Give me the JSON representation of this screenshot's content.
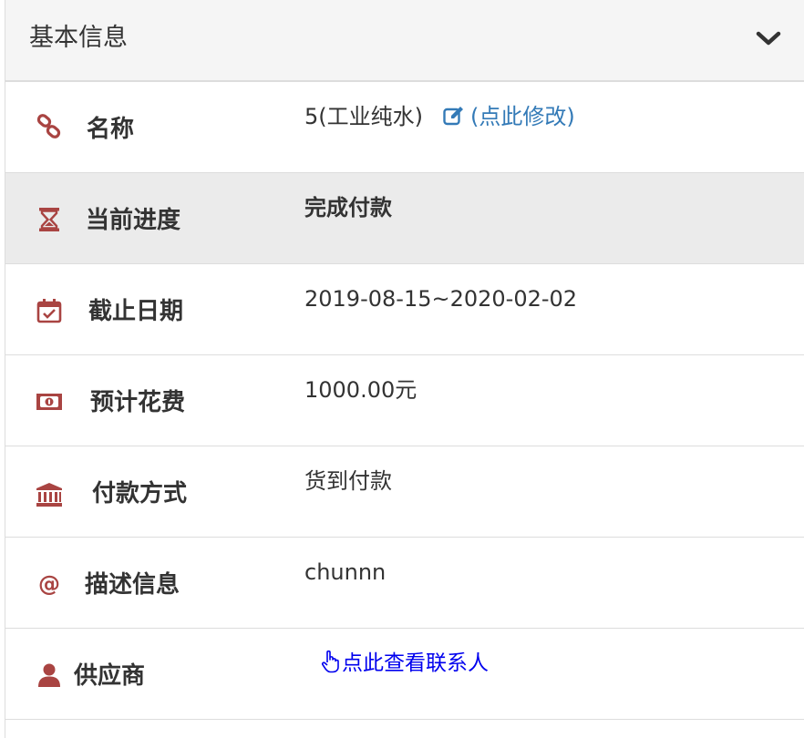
{
  "panel": {
    "title": "基本信息",
    "toggle_icon": "chevron-down-icon"
  },
  "rows": {
    "name": {
      "label": "名称",
      "icon": "link-icon",
      "value": "5(工业纯水)",
      "edit_label": "(点此修改)",
      "edit_icon": "edit-icon"
    },
    "progress": {
      "label": "当前进度",
      "icon": "hourglass-icon",
      "value": "完成付款"
    },
    "deadline": {
      "label": "截止日期",
      "icon": "calendar-check-icon",
      "value": "2019-08-15~2020-02-02"
    },
    "cost": {
      "label": "预计花费",
      "icon": "money-icon",
      "value": "1000.00元"
    },
    "payment": {
      "label": "付款方式",
      "icon": "bank-icon",
      "value": "货到付款"
    },
    "description": {
      "label": "描述信息",
      "icon": "at-icon",
      "value": "chunnn"
    },
    "supplier": {
      "label": "供应商",
      "icon": "user-icon",
      "link_label": "点此查看联系人",
      "link_icon": "hand-pointer-icon"
    }
  },
  "colors": {
    "icon": "#a94442",
    "link": "#337ab7",
    "contact_link": "#0000ee",
    "header_bg": "#f5f5f5",
    "alt_row_bg": "#ebebeb"
  }
}
